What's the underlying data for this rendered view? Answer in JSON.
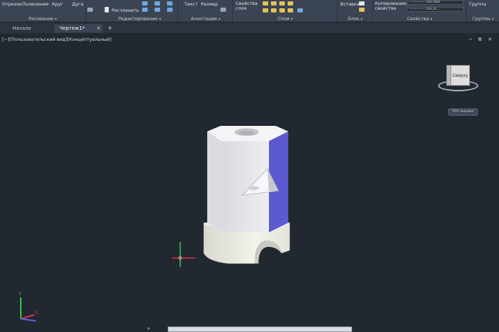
{
  "ribbon": {
    "draw": {
      "line": "Отрезок",
      "polyline": "Полилиния",
      "circle": "Круг",
      "arc": "Дуга",
      "title": "Рисование"
    },
    "modify": {
      "explode": "Расчленить",
      "title": "Редактирование"
    },
    "annotation": {
      "text": "Текст",
      "dimension": "Размер",
      "title": "Аннотации"
    },
    "layers": {
      "layer_props": "Свойства слоя",
      "title": "Слои"
    },
    "block": {
      "insert": "Вставка",
      "title": "Блок"
    },
    "properties": {
      "copy_props": "Копирование свойства",
      "line_value_1": "———— Послой",
      "line_value_2": "———— ПоСл...",
      "title": "Свойства"
    },
    "groups": {
      "group": "Группа",
      "title": "Группы"
    },
    "caret": "▾"
  },
  "tabs": [
    {
      "label": "Начало"
    },
    {
      "label": "Чертеж1*"
    }
  ],
  "tab_add": "+",
  "tab_close": "✕",
  "viewport": {
    "label": "[−][Пользовательский вид][Концептуальный]",
    "controls": [
      "−",
      "⧉",
      "✕"
    ]
  },
  "viewcube": {
    "face": "Сверху",
    "wcs_button": "ПСК мировая"
  },
  "colors": {
    "background": "#212830",
    "ribbon": "#3b4453",
    "model_light": "#e9e9ec",
    "model_shadow_face": "#5b5ad0",
    "axis_x": "#e0323b",
    "axis_y": "#2fd14a",
    "axis_z": "#4f6cf0"
  },
  "axes": {
    "x_label": "X",
    "y_label": "Y"
  },
  "cmd": {
    "close": "✕",
    "placeholder": ""
  }
}
